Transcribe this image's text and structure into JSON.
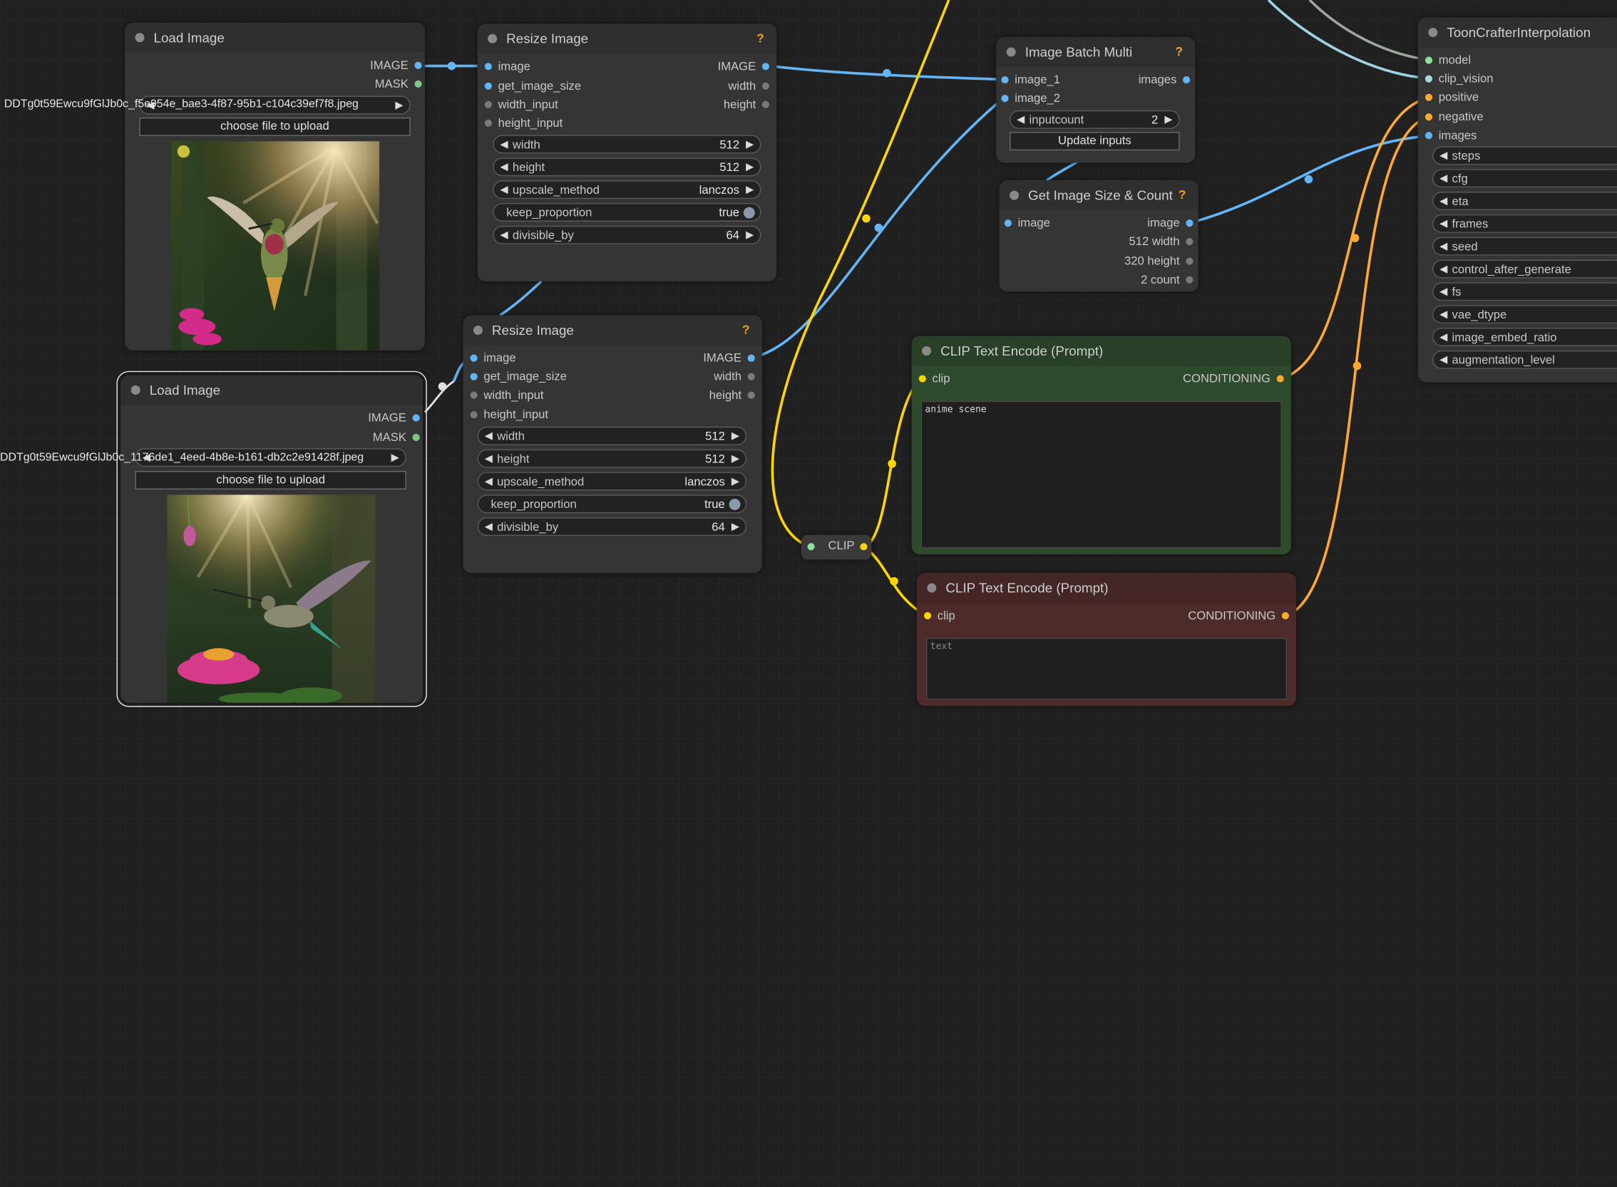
{
  "colors": {
    "image": "#64b5f6",
    "mask": "#81c784",
    "clip": "#ffd500",
    "conditioning": "#ffa931",
    "int": "#7a7a7a",
    "green_node": "#2d4a2d",
    "red_node": "#4e2b2b"
  },
  "load_image_1": {
    "title": "Load Image",
    "outputs": [
      "IMAGE",
      "MASK"
    ],
    "file_left": "DDTg0t59Ewcu9fGlJb0c_f5",
    "file_right": "e954e_bae3-4f87-95b1-c104c39ef7f8.jpeg",
    "upload_label": "choose file to upload"
  },
  "load_image_2": {
    "title": "Load Image",
    "outputs": [
      "IMAGE",
      "MASK"
    ],
    "file_left": "DDTg0t59Ewcu9fGlJb0c_117",
    "file_right": "6de1_4eed-4b8e-b161-db2c2e91428f.jpeg",
    "upload_label": "choose file to upload"
  },
  "resize_image_1": {
    "title": "Resize Image",
    "help": "?",
    "inputs": [
      "image",
      "get_image_size",
      "width_input",
      "height_input"
    ],
    "outputs": [
      "IMAGE",
      "width",
      "height"
    ],
    "widgets": {
      "width": {
        "label": "width",
        "value": "512"
      },
      "height": {
        "label": "height",
        "value": "512"
      },
      "upscale_method": {
        "label": "upscale_method",
        "value": "lanczos"
      },
      "keep_proportion": {
        "label": "keep_proportion",
        "value": "true"
      },
      "divisible_by": {
        "label": "divisible_by",
        "value": "64"
      }
    }
  },
  "resize_image_2": {
    "title": "Resize Image",
    "help": "?",
    "inputs": [
      "image",
      "get_image_size",
      "width_input",
      "height_input"
    ],
    "outputs": [
      "IMAGE",
      "width",
      "height"
    ],
    "widgets": {
      "width": {
        "label": "width",
        "value": "512"
      },
      "height": {
        "label": "height",
        "value": "512"
      },
      "upscale_method": {
        "label": "upscale_method",
        "value": "lanczos"
      },
      "keep_proportion": {
        "label": "keep_proportion",
        "value": "true"
      },
      "divisible_by": {
        "label": "divisible_by",
        "value": "64"
      }
    }
  },
  "image_batch_multi": {
    "title": "Image Batch Multi",
    "help": "?",
    "inputs": [
      "image_1",
      "image_2"
    ],
    "outputs": [
      "images"
    ],
    "inputcount_label": "inputcount",
    "inputcount_value": "2",
    "update_button": "Update inputs"
  },
  "get_image_size": {
    "title": "Get Image Size & Count",
    "help": "?",
    "inputs": [
      "image"
    ],
    "outputs": [
      "image",
      "512 width",
      "320 height",
      "2 count"
    ]
  },
  "clip_reroute": {
    "label": "CLIP"
  },
  "clip_text_encode_pos": {
    "title": "CLIP Text Encode (Prompt)",
    "input": "clip",
    "output": "CONDITIONING",
    "text": "anime scene"
  },
  "clip_text_encode_neg": {
    "title": "CLIP Text Encode (Prompt)",
    "input": "clip",
    "output": "CONDITIONING",
    "placeholder": "text"
  },
  "toon_crafter": {
    "title": "ToonCrafterInterpolation",
    "inputs": [
      "model",
      "clip_vision",
      "positive",
      "negative",
      "images"
    ],
    "widgets": [
      "steps",
      "cfg",
      "eta",
      "frames",
      "seed",
      "control_after_generate",
      "fs",
      "vae_dtype",
      "image_embed_ratio",
      "augmentation_level"
    ]
  }
}
